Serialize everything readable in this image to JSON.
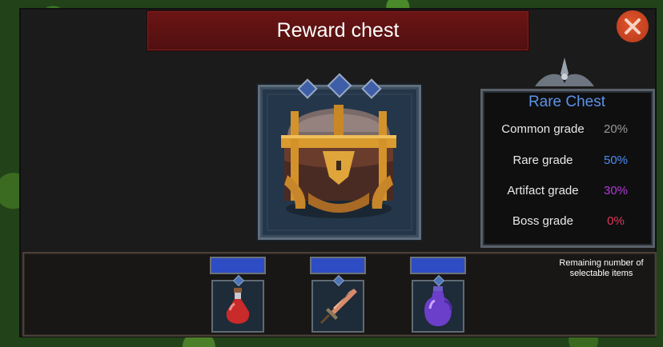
{
  "window": {
    "title": "Reward chest"
  },
  "chest": {
    "name": "Rare Chest",
    "icon": "treasure-chest-icon",
    "grades": [
      {
        "label": "Common grade",
        "percent": "20%",
        "color": "#9a9a9a"
      },
      {
        "label": "Rare grade",
        "percent": "50%",
        "color": "#4f8ef0"
      },
      {
        "label": "Artifact grade",
        "percent": "30%",
        "color": "#b03ad6"
      },
      {
        "label": "Boss grade",
        "percent": "0%",
        "color": "#e0385a"
      }
    ]
  },
  "selection": {
    "remaining_label": "Remaining number of selectable items",
    "items": [
      {
        "icon": "red-potion-icon"
      },
      {
        "icon": "sword-icon"
      },
      {
        "icon": "purple-potion-icon"
      }
    ]
  },
  "colors": {
    "accent_blue": "#2e4cc4",
    "title_red": "#5e1212",
    "close_orange": "#d64a24"
  }
}
